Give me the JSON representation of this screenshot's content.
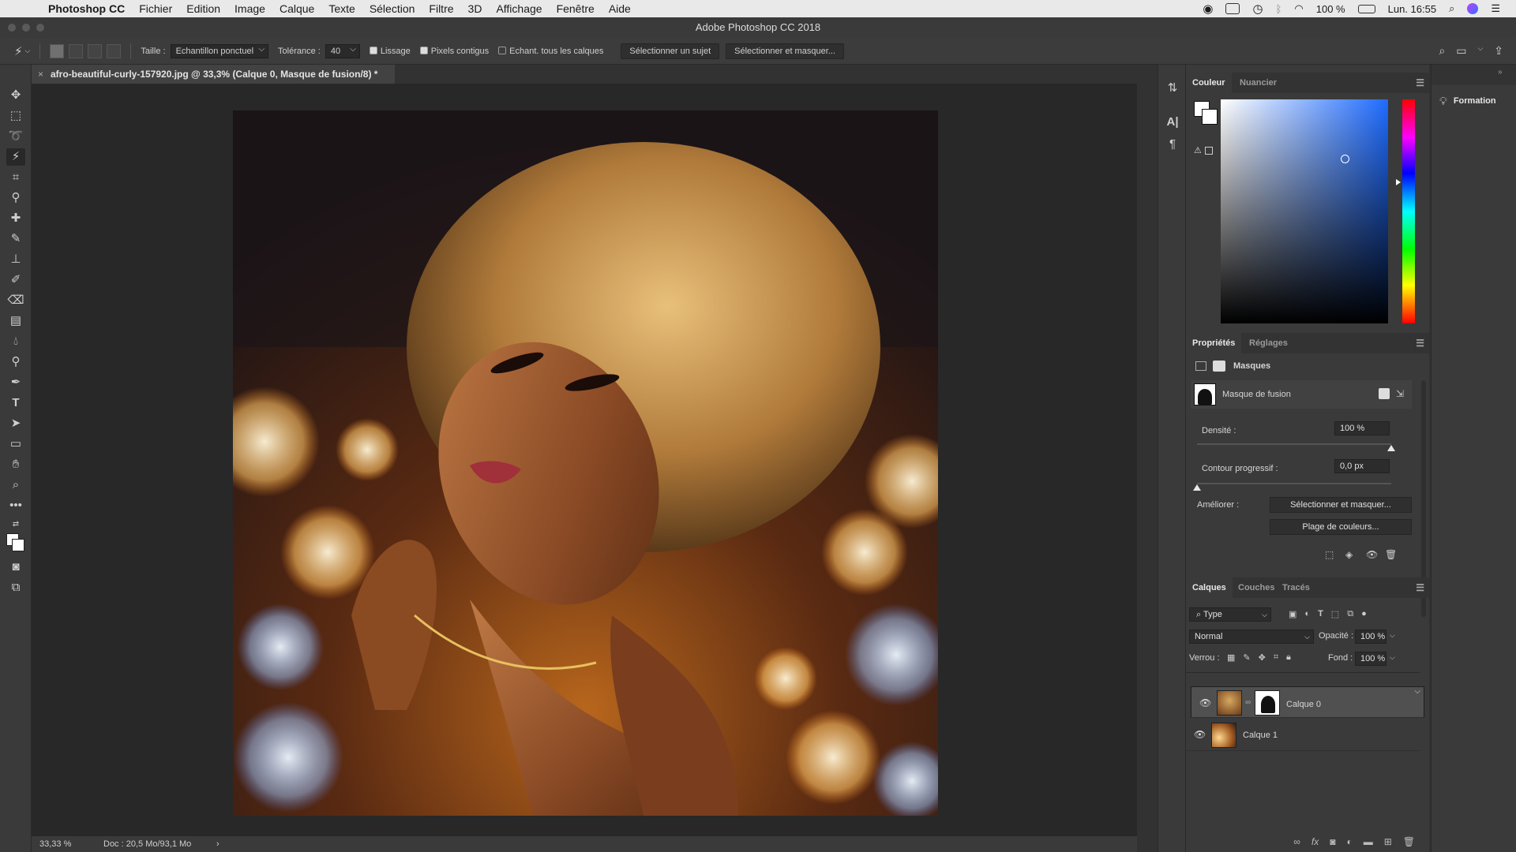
{
  "menubar": {
    "app": "Photoshop CC",
    "items": [
      "Fichier",
      "Edition",
      "Image",
      "Calque",
      "Texte",
      "Sélection",
      "Filtre",
      "3D",
      "Affichage",
      "Fenêtre",
      "Aide"
    ],
    "battery": "100 %",
    "clock": "Lun. 16:55"
  },
  "window": {
    "title": "Adobe Photoshop CC 2018"
  },
  "options": {
    "size_label": "Taille :",
    "size_value": "Echantillon ponctuel",
    "tolerance_label": "Tolérance :",
    "tolerance_value": "40",
    "antialias": "Lissage",
    "contiguous": "Pixels contigus",
    "sample_all": "Echant. tous les calques",
    "select_subject": "Sélectionner un sujet",
    "select_mask": "Sélectionner et masquer..."
  },
  "document": {
    "tab_title": "afro-beautiful-curly-157920.jpg @ 33,3% (Calque 0, Masque de fusion/8) *",
    "zoom": "33,33 %",
    "doc_info": "Doc : 20,5 Mo/93,1 Mo",
    "expand": "›"
  },
  "color_panel": {
    "tabs": [
      "Couleur",
      "Nuancier"
    ]
  },
  "properties": {
    "tabs": [
      "Propriétés",
      "Réglages"
    ],
    "section": "Masques",
    "mask_name": "Masque de fusion",
    "density_label": "Densité :",
    "density_value": "100 %",
    "density_level": 1.0,
    "feather_label": "Contour progressif :",
    "feather_value": "0,0 px",
    "feather_level": 0.0,
    "refine_label": "Améliorer :",
    "refine_btn1": "Sélectionner et masquer...",
    "refine_btn2": "Plage de couleurs..."
  },
  "layers": {
    "tabs": [
      "Calques",
      "Couches",
      "Tracés"
    ],
    "filter": "Type",
    "blend": "Normal",
    "opacity_label": "Opacité :",
    "opacity_value": "100 %",
    "lock_label": "Verrou :",
    "fill_label": "Fond :",
    "fill_value": "100 %",
    "items": [
      {
        "name": "Calque 0",
        "selected": true
      },
      {
        "name": "Calque 1",
        "selected": false
      }
    ]
  },
  "learn": {
    "label": "Formation"
  }
}
